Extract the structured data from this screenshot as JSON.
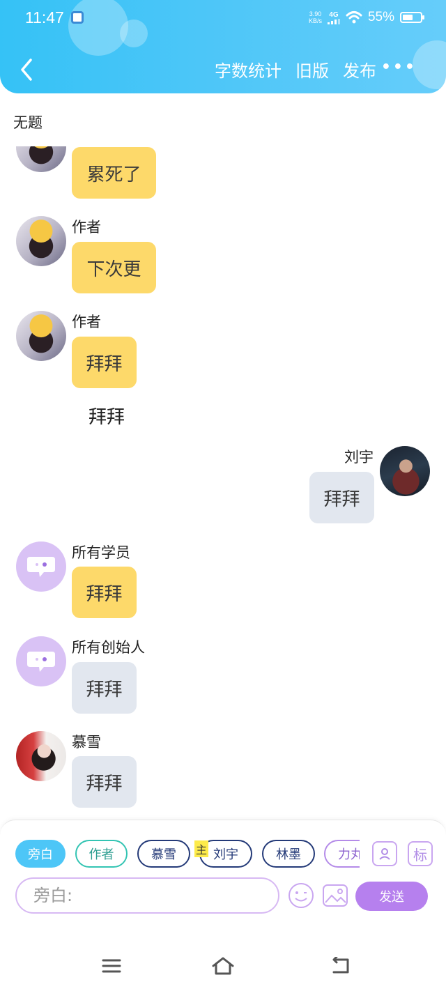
{
  "status_bar": {
    "time": "11:47",
    "net_speed_value": "3.90",
    "net_speed_unit": "KB/s",
    "signal": "4G",
    "battery_pct": "55%",
    "battery_level": 0.55
  },
  "header": {
    "actions": [
      "字数统计",
      "旧版",
      "发布"
    ],
    "more": "•••"
  },
  "doc_title": "无题",
  "messages": [
    {
      "side": "left",
      "avatar": "avatar-girl",
      "name": "",
      "text": "累死了",
      "bubble": "yellow"
    },
    {
      "side": "left",
      "avatar": "avatar-girl",
      "name": "作者",
      "text": "下次更",
      "bubble": "yellow"
    },
    {
      "side": "left",
      "avatar": "avatar-girl",
      "name": "作者",
      "text": "拜拜",
      "bubble": "yellow"
    },
    {
      "type": "narration",
      "text": "拜拜"
    },
    {
      "side": "right",
      "avatar": "avatar-man",
      "name": "刘宇",
      "text": "拜拜",
      "bubble": "gray"
    },
    {
      "side": "left",
      "avatar": "chat-bubble-icon",
      "name": "所有学员",
      "text": "拜拜",
      "bubble": "yellow"
    },
    {
      "side": "left",
      "avatar": "chat-bubble-icon",
      "name": "所有创始人",
      "text": "拜拜",
      "bubble": "gray"
    },
    {
      "side": "left",
      "avatar": "avatar-snow",
      "name": "慕雪",
      "text": "拜拜",
      "bubble": "gray"
    }
  ],
  "role_chips": [
    "旁白",
    "作者",
    "慕雪",
    "刘宇",
    "林墨",
    "力丸"
  ],
  "host_tag": "主",
  "panel_icons": {
    "character": "character-icon",
    "mark": "标"
  },
  "input": {
    "placeholder": "旁白:"
  },
  "send_label": "发送",
  "colors": {
    "header_blue": "#4cc6f7",
    "bubble_yellow": "#fdd96a",
    "bubble_gray": "#e2e7ef",
    "accent_purple": "#b680ee",
    "chip_teal": "#33c4b3",
    "chip_navy": "#243a78"
  }
}
